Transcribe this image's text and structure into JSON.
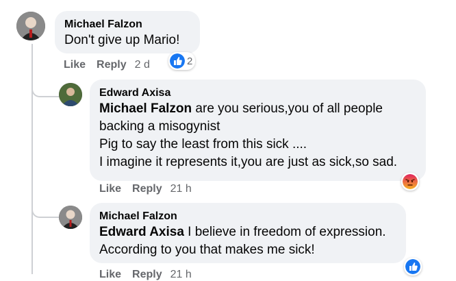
{
  "comments": [
    {
      "author": "Michael Falzon",
      "lines": [
        "Don't give up Mario!"
      ],
      "actions": {
        "like": "Like",
        "reply": "Reply",
        "time": "2 d"
      },
      "reaction": {
        "icon": "like-icon",
        "count": "2"
      }
    },
    {
      "author": "Edward Axisa",
      "mention": "Michael Falzon",
      "lines": [
        " are you serious,you of all people",
        "backing a misogynist",
        "Pig to say the least from this sick ....",
        "I imagine it represents it,you are just as sick,so sad."
      ],
      "actions": {
        "like": "Like",
        "reply": "Reply",
        "time": "21 h"
      },
      "reaction": {
        "icon": "angry-icon"
      }
    },
    {
      "author": "Michael Falzon",
      "mention": "Edward Axisa",
      "lines": [
        " I believe in freedom of expression.",
        "According to you that makes me sick!"
      ],
      "actions": {
        "like": "Like",
        "reply": "Reply",
        "time": "21 h"
      },
      "reaction": {
        "icon": "like-icon"
      }
    }
  ],
  "colors": {
    "bubble": "#f0f2f5",
    "secondary_text": "#65676b",
    "like_blue": "#1877f2",
    "angry_orange": "#e9710f"
  }
}
